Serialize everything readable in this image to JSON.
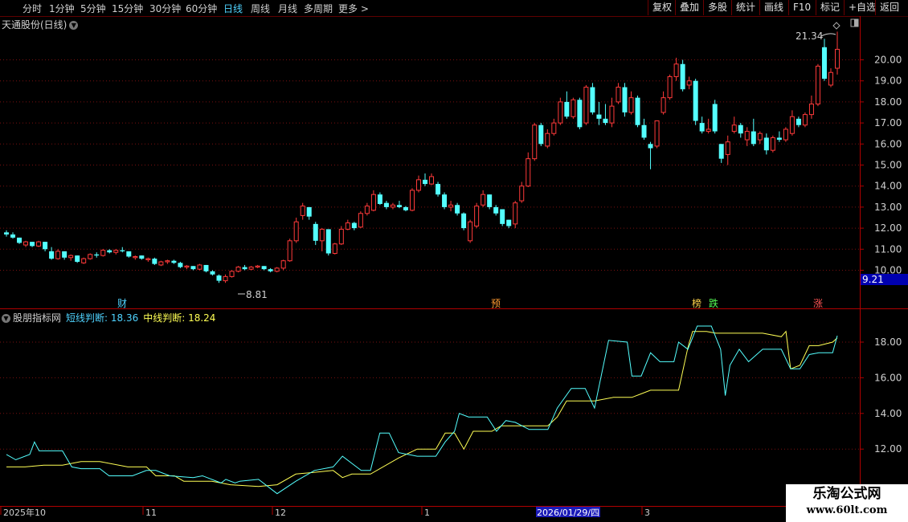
{
  "toolbar": {
    "periods": [
      "分时",
      "1分钟",
      "5分钟",
      "15分钟",
      "30分钟",
      "60分钟",
      "日线",
      "周线",
      "月线",
      "多周期",
      "更多 >"
    ],
    "active_period": "日线",
    "buttons": [
      "复权",
      "叠加",
      "多股",
      "统计",
      "画线",
      "F10",
      "标记",
      "+自选",
      "返回"
    ]
  },
  "main_chart": {
    "title": "天通股份(日线)",
    "price_ticks": [
      "20.00",
      "19.00",
      "18.00",
      "17.00",
      "16.00",
      "15.00",
      "14.00",
      "13.00",
      "12.00",
      "11.00",
      "10.00"
    ],
    "high_label": "21.34",
    "low_label": "8.81",
    "current_price": "9.21",
    "markers": [
      {
        "text": "财",
        "color": "#4fd3ff"
      },
      {
        "text": "预",
        "color": "#ff9a30"
      },
      {
        "text": "榜",
        "color": "#ffd24a"
      },
      {
        "text": "跌",
        "color": "#55ff55"
      },
      {
        "text": "涨",
        "color": "#ff5555"
      }
    ],
    "up_color": "#ff3a3a",
    "down_color": "#54ffff"
  },
  "indicator": {
    "name": "股朋指标网",
    "short_label": "短线判断: 18.36",
    "mid_label": "中线判断: 18.24",
    "ticks": [
      "18.00",
      "16.00",
      "14.00",
      "12.00"
    ],
    "short_color": "#54ffff",
    "mid_color": "#ffff55"
  },
  "date_axis": {
    "labels": [
      "2025年10",
      "11",
      "12",
      "1",
      "2026/01/29/四",
      "3"
    ]
  },
  "watermark": {
    "line1": "乐淘公式网",
    "line2": "www.60lt.com"
  },
  "chart_data": {
    "type": "candlestick",
    "title": "天通股份(日线)",
    "ylim": [
      9.2,
      21.6
    ],
    "candles": [
      [
        11.8,
        11.9,
        11.6,
        11.7
      ],
      [
        11.7,
        11.8,
        11.5,
        11.55
      ],
      [
        11.55,
        11.55,
        11.25,
        11.3
      ],
      [
        11.2,
        11.4,
        11.1,
        11.35
      ],
      [
        11.35,
        11.35,
        11.1,
        11.15
      ],
      [
        11.15,
        11.4,
        11.1,
        11.35
      ],
      [
        11.35,
        11.35,
        10.9,
        11.0
      ],
      [
        10.9,
        11.1,
        10.5,
        10.55
      ],
      [
        10.55,
        11.0,
        10.5,
        10.9
      ],
      [
        10.9,
        10.9,
        10.5,
        10.6
      ],
      [
        10.6,
        10.75,
        10.45,
        10.7
      ],
      [
        10.7,
        10.7,
        10.35,
        10.4
      ],
      [
        10.35,
        10.6,
        10.3,
        10.55
      ],
      [
        10.55,
        10.8,
        10.5,
        10.75
      ],
      [
        10.75,
        10.85,
        10.6,
        10.7
      ],
      [
        10.7,
        11.0,
        10.65,
        10.95
      ],
      [
        10.95,
        11.0,
        10.8,
        10.85
      ],
      [
        10.85,
        11.0,
        10.75,
        10.95
      ],
      [
        10.95,
        11.1,
        10.85,
        10.9
      ],
      [
        10.9,
        10.9,
        10.6,
        10.65
      ],
      [
        10.6,
        10.7,
        10.5,
        10.65
      ],
      [
        10.7,
        10.7,
        10.5,
        10.55
      ],
      [
        10.5,
        10.6,
        10.4,
        10.55
      ],
      [
        10.55,
        10.6,
        10.25,
        10.3
      ],
      [
        10.25,
        10.45,
        10.2,
        10.4
      ],
      [
        10.4,
        10.5,
        10.3,
        10.45
      ],
      [
        10.45,
        10.5,
        10.3,
        10.35
      ],
      [
        10.35,
        10.4,
        10.1,
        10.15
      ],
      [
        10.15,
        10.25,
        10.05,
        10.2
      ],
      [
        10.2,
        10.2,
        10.0,
        10.05
      ],
      [
        10.05,
        10.3,
        10.0,
        10.25
      ],
      [
        10.25,
        10.25,
        9.9,
        9.95
      ],
      [
        9.95,
        10.0,
        9.75,
        9.8
      ],
      [
        9.75,
        9.8,
        9.4,
        9.5
      ],
      [
        9.5,
        9.8,
        9.4,
        9.7
      ],
      [
        9.7,
        10.0,
        9.65,
        9.95
      ],
      [
        9.95,
        10.2,
        9.9,
        10.15
      ],
      [
        10.15,
        10.25,
        10.0,
        10.05
      ],
      [
        10.05,
        10.2,
        10.0,
        10.15
      ],
      [
        10.15,
        10.25,
        10.1,
        10.2
      ],
      [
        10.2,
        10.2,
        10.0,
        10.05
      ],
      [
        10.05,
        10.1,
        9.9,
        9.95
      ],
      [
        9.95,
        10.15,
        9.9,
        10.1
      ],
      [
        10.1,
        10.5,
        10.0,
        10.45
      ],
      [
        10.45,
        11.5,
        10.4,
        11.4
      ],
      [
        11.4,
        12.5,
        11.3,
        12.3
      ],
      [
        12.6,
        13.2,
        12.4,
        13.05
      ],
      [
        13.0,
        13.0,
        12.4,
        12.55
      ],
      [
        12.2,
        12.3,
        11.2,
        11.4
      ],
      [
        11.4,
        12.0,
        10.9,
        11.95
      ],
      [
        11.95,
        11.95,
        10.7,
        10.8
      ],
      [
        10.8,
        11.3,
        10.75,
        11.25
      ],
      [
        11.25,
        12.1,
        11.2,
        11.95
      ],
      [
        11.95,
        12.4,
        11.9,
        12.25
      ],
      [
        12.25,
        12.3,
        11.9,
        12.0
      ],
      [
        12.05,
        12.8,
        12.0,
        12.7
      ],
      [
        12.7,
        13.2,
        12.6,
        13.05
      ],
      [
        12.85,
        13.8,
        12.8,
        13.6
      ],
      [
        13.6,
        13.7,
        13.1,
        13.15
      ],
      [
        13.2,
        13.3,
        12.9,
        13.0
      ],
      [
        13.0,
        13.2,
        12.9,
        13.1
      ],
      [
        13.1,
        13.3,
        12.95,
        13.0
      ],
      [
        13.0,
        13.05,
        12.8,
        12.85
      ],
      [
        12.85,
        13.9,
        12.8,
        13.8
      ],
      [
        13.8,
        14.5,
        13.7,
        14.3
      ],
      [
        14.3,
        14.6,
        14.0,
        14.1
      ],
      [
        14.1,
        14.6,
        14.05,
        14.45
      ],
      [
        14.1,
        14.2,
        13.5,
        13.6
      ],
      [
        13.6,
        13.7,
        12.9,
        13.0
      ],
      [
        13.0,
        13.3,
        12.8,
        13.1
      ],
      [
        13.1,
        13.2,
        12.6,
        12.7
      ],
      [
        12.7,
        12.75,
        11.9,
        12.0
      ],
      [
        11.4,
        12.4,
        11.3,
        12.3
      ],
      [
        12.1,
        13.2,
        12.0,
        13.05
      ],
      [
        13.1,
        13.8,
        13.0,
        13.6
      ],
      [
        13.6,
        13.6,
        12.9,
        13.0
      ],
      [
        13.0,
        13.1,
        12.6,
        12.7
      ],
      [
        12.9,
        12.9,
        12.1,
        12.2
      ],
      [
        12.4,
        12.4,
        12.0,
        12.1
      ],
      [
        12.2,
        13.3,
        12.0,
        13.2
      ],
      [
        13.3,
        14.2,
        13.2,
        14.0
      ],
      [
        14.0,
        15.6,
        13.95,
        15.3
      ],
      [
        15.3,
        17.0,
        15.2,
        16.9
      ],
      [
        16.9,
        17.0,
        15.9,
        16.0
      ],
      [
        15.9,
        16.7,
        15.8,
        16.5
      ],
      [
        16.5,
        17.2,
        16.4,
        17.0
      ],
      [
        17.0,
        18.2,
        16.9,
        18.0
      ],
      [
        18.0,
        18.5,
        17.2,
        17.3
      ],
      [
        17.3,
        18.2,
        17.2,
        18.1
      ],
      [
        18.1,
        18.2,
        16.7,
        16.8
      ],
      [
        17.0,
        18.8,
        16.9,
        18.7
      ],
      [
        18.7,
        18.9,
        17.4,
        17.5
      ],
      [
        17.4,
        18.0,
        16.9,
        17.2
      ],
      [
        17.2,
        17.9,
        16.9,
        17.0
      ],
      [
        17.0,
        18.2,
        16.8,
        17.8
      ],
      [
        18.0,
        18.9,
        17.9,
        18.7
      ],
      [
        18.7,
        18.9,
        17.3,
        17.5
      ],
      [
        17.5,
        18.5,
        17.4,
        18.2
      ],
      [
        18.2,
        18.3,
        16.8,
        16.9
      ],
      [
        16.9,
        17.2,
        16.2,
        16.3
      ],
      [
        16.0,
        16.1,
        14.8,
        15.8
      ],
      [
        15.9,
        16.9,
        15.8,
        17.1
      ],
      [
        17.5,
        18.5,
        17.4,
        18.2
      ],
      [
        18.2,
        19.3,
        18.1,
        19.2
      ],
      [
        19.2,
        20.1,
        19.0,
        19.8
      ],
      [
        19.8,
        20.0,
        18.5,
        18.6
      ],
      [
        18.8,
        19.2,
        18.6,
        19.0
      ],
      [
        19.0,
        19.1,
        16.9,
        17.1
      ],
      [
        17.0,
        17.3,
        16.5,
        16.6
      ],
      [
        16.6,
        17.2,
        16.5,
        16.7
      ],
      [
        17.9,
        18.1,
        16.5,
        16.6
      ],
      [
        16.0,
        16.0,
        15.1,
        15.3
      ],
      [
        15.5,
        16.4,
        15.0,
        16.1
      ],
      [
        16.6,
        17.3,
        16.5,
        16.9
      ],
      [
        16.9,
        17.0,
        16.3,
        16.5
      ],
      [
        16.2,
        16.8,
        15.9,
        16.6
      ],
      [
        16.6,
        17.2,
        15.9,
        16.0
      ],
      [
        16.2,
        16.6,
        16.0,
        16.5
      ],
      [
        16.3,
        16.5,
        15.5,
        15.7
      ],
      [
        15.7,
        16.4,
        15.6,
        16.3
      ],
      [
        16.3,
        16.6,
        16.1,
        16.2
      ],
      [
        16.2,
        16.8,
        16.1,
        16.7
      ],
      [
        16.5,
        17.6,
        16.4,
        17.3
      ],
      [
        17.2,
        17.3,
        16.8,
        16.9
      ],
      [
        16.9,
        17.5,
        16.8,
        17.4
      ],
      [
        17.4,
        18.3,
        17.2,
        17.9
      ],
      [
        17.9,
        19.8,
        17.8,
        19.7
      ],
      [
        20.6,
        21.0,
        19.0,
        19.1
      ],
      [
        18.8,
        19.6,
        18.7,
        19.4
      ],
      [
        19.6,
        21.34,
        19.3,
        20.5
      ]
    ]
  }
}
